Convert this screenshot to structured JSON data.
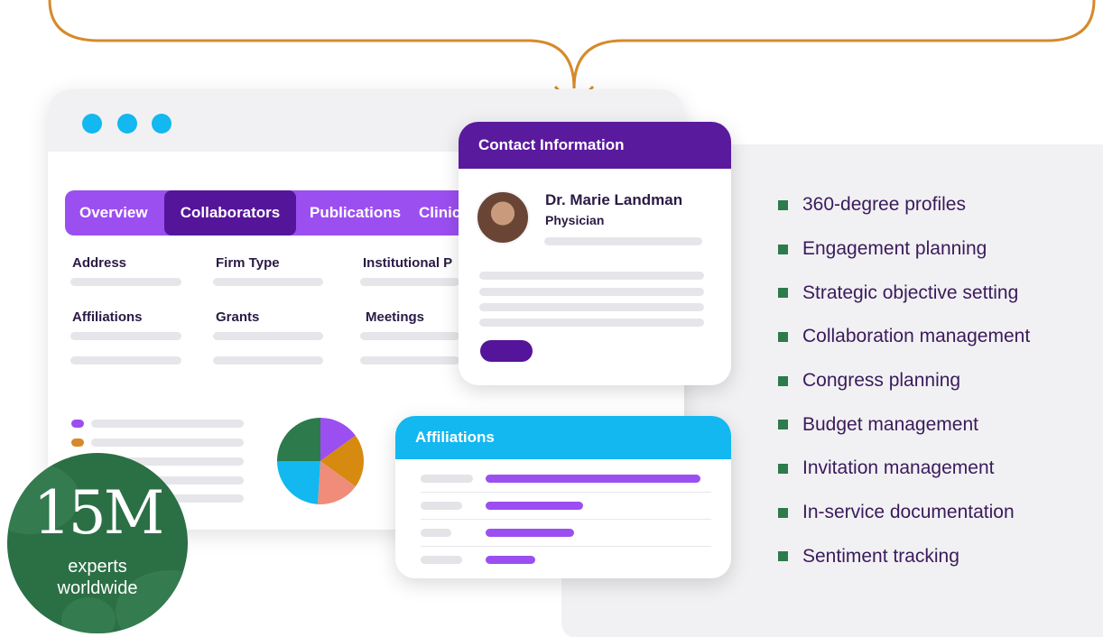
{
  "colors": {
    "accent_orange": "#d68a2b",
    "tab_purple": "#9b4ff0",
    "tab_active": "#55159a",
    "contact_header": "#5a1a9e",
    "affiliations_header": "#12b8ef",
    "bullet_green": "#2d7a4c",
    "badge_green": "#2b6f45"
  },
  "browser": {
    "tabs": [
      {
        "label": "Overview",
        "active": false
      },
      {
        "label": "Collaborators",
        "active": true
      },
      {
        "label": "Publications",
        "active": false
      },
      {
        "label": "Clinic",
        "active": false
      }
    ],
    "fields": {
      "address": "Address",
      "firm_type": "Firm Type",
      "institutional": "Institutional P",
      "affiliations": "Affiliations",
      "grants": "Grants",
      "meetings": "Meetings"
    },
    "legend_colors": [
      "#9b4ff0",
      "#d68a2b"
    ]
  },
  "chart_data": {
    "type": "pie",
    "values": [
      15,
      20,
      16,
      24,
      25
    ],
    "colors": [
      "#9b4ff0",
      "#d68a10",
      "#ef8c7a",
      "#12b8ef",
      "#2d7a4c"
    ]
  },
  "contact_card": {
    "title": "Contact Information",
    "name": "Dr. Marie Landman",
    "role": "Physician"
  },
  "affiliations_card": {
    "title": "Affiliations",
    "row_fill": [
      0.95,
      0.43,
      0.39,
      0.22
    ]
  },
  "features": [
    "360-degree profiles",
    "Engagement planning",
    "Strategic objective setting",
    "Collaboration management",
    "Congress planning",
    "Budget management",
    "Invitation management",
    "In-service documentation",
    "Sentiment tracking"
  ],
  "badge": {
    "number": "15M",
    "line1": "experts",
    "line2": "worldwide"
  }
}
